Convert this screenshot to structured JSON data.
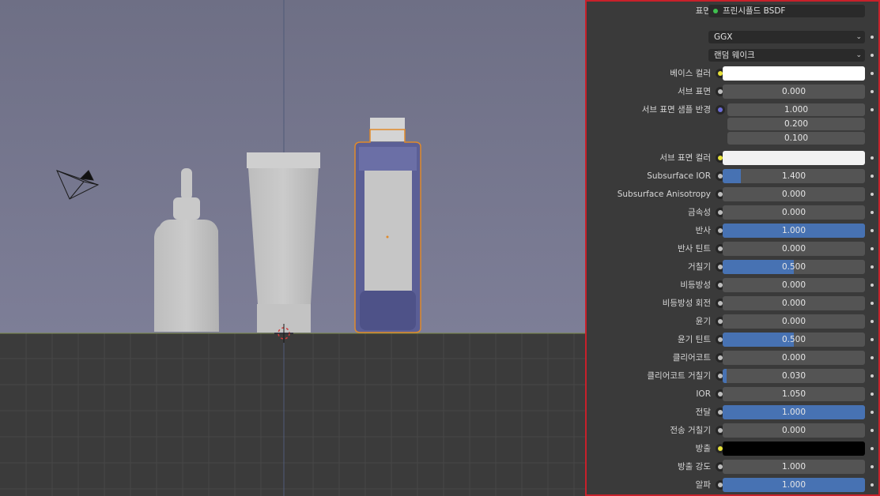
{
  "panel": {
    "surface": {
      "label": "표면",
      "value": "프린시플드 BSDF"
    },
    "distribution": "GGX",
    "subsurface_method": "랜덤 웨이크",
    "props": [
      {
        "label": "베이스 컬러",
        "kind": "color",
        "color": "#ffffff",
        "socket": "yellow"
      },
      {
        "label": "서브 표면",
        "kind": "num",
        "value": "0.000",
        "fill": 0.0
      },
      {
        "label": "서브 표면 샘플 반경",
        "kind": "vec",
        "values": [
          "1.000",
          "0.200",
          "0.100"
        ],
        "socket": "purple"
      },
      {
        "label": "서브 표면 컬러",
        "kind": "color",
        "color": "#f2f2f2",
        "socket": "yellow"
      },
      {
        "label": "Subsurface IOR",
        "kind": "num",
        "value": "1.400",
        "fill": 0.13
      },
      {
        "label": "Subsurface Anisotropy",
        "kind": "num",
        "value": "0.000",
        "fill": 0.0
      },
      {
        "label": "금속성",
        "kind": "num",
        "value": "0.000",
        "fill": 0.0
      },
      {
        "label": "반사",
        "kind": "num",
        "value": "1.000",
        "fill": 1.0
      },
      {
        "label": "반사 틴트",
        "kind": "num",
        "value": "0.000",
        "fill": 0.0
      },
      {
        "label": "거칠기",
        "kind": "num",
        "value": "0.500",
        "fill": 0.5
      },
      {
        "label": "비등방성",
        "kind": "num",
        "value": "0.000",
        "fill": 0.0
      },
      {
        "label": "비등방성 회전",
        "kind": "num",
        "value": "0.000",
        "fill": 0.0
      },
      {
        "label": "윤기",
        "kind": "num",
        "value": "0.000",
        "fill": 0.0
      },
      {
        "label": "윤기 틴트",
        "kind": "num",
        "value": "0.500",
        "fill": 0.5
      },
      {
        "label": "클리어코트",
        "kind": "num",
        "value": "0.000",
        "fill": 0.0
      },
      {
        "label": "클리어코트 거칠기",
        "kind": "num",
        "value": "0.030",
        "fill": 0.03
      },
      {
        "label": "IOR",
        "kind": "num",
        "value": "1.050",
        "fill": 0.0
      },
      {
        "label": "전달",
        "kind": "num",
        "value": "1.000",
        "fill": 1.0
      },
      {
        "label": "전송 거칠기",
        "kind": "num",
        "value": "0.000",
        "fill": 0.0
      },
      {
        "label": "방출",
        "kind": "color",
        "color": "#000000",
        "socket": "yellow"
      },
      {
        "label": "방출 강도",
        "kind": "num",
        "value": "1.000",
        "fill": 0.0
      },
      {
        "label": "알파",
        "kind": "num",
        "value": "1.000",
        "fill": 1.0
      }
    ]
  },
  "colors": {
    "accent": "#4772b3",
    "highlight_border": "#c8202a",
    "selection_outline": "#e08a2a"
  }
}
